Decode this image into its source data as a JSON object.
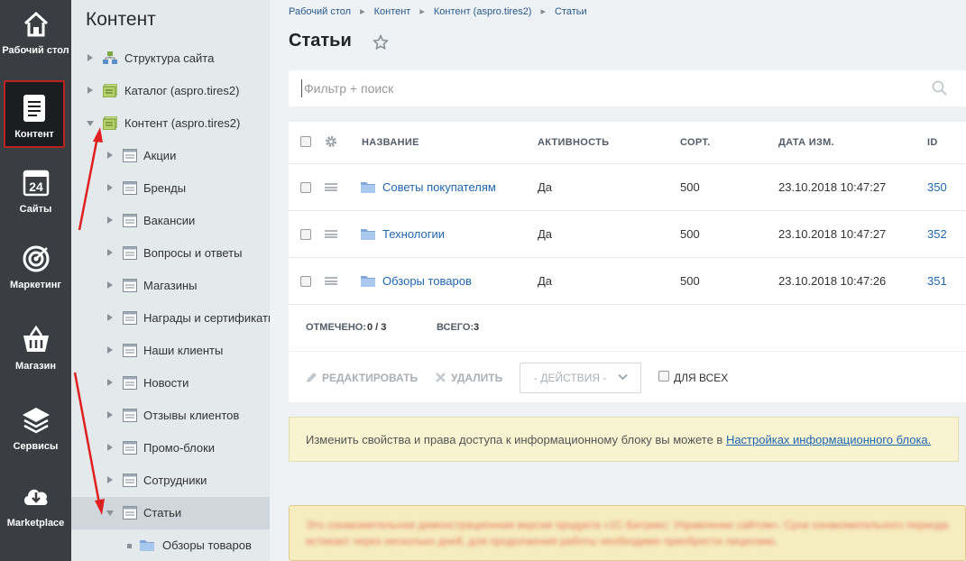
{
  "rail": {
    "items": [
      {
        "label": "Рабочий стол",
        "icon": "home-icon"
      },
      {
        "label": "Контент",
        "icon": "document-icon",
        "active": true
      },
      {
        "label": "Сайты",
        "icon": "calendar-24-icon"
      },
      {
        "label": "Маркетинг",
        "icon": "target-icon"
      },
      {
        "label": "Магазин",
        "icon": "basket-icon"
      },
      {
        "label": "Сервисы",
        "icon": "layers-icon"
      },
      {
        "label": "Marketplace",
        "icon": "cloud-download-icon"
      }
    ]
  },
  "tree": {
    "title": "Контент",
    "items": [
      {
        "label": "Структура сайта",
        "icon": "site-structure-icon"
      },
      {
        "label": "Каталог (aspro.tires2)",
        "icon": "iblock-type-icon"
      },
      {
        "label": "Контент (aspro.tires2)",
        "icon": "iblock-type-icon",
        "expanded": true
      },
      {
        "label": "Акции",
        "icon": "iblock-icon"
      },
      {
        "label": "Бренды",
        "icon": "iblock-icon"
      },
      {
        "label": "Вакансии",
        "icon": "iblock-icon"
      },
      {
        "label": "Вопросы и ответы",
        "icon": "iblock-icon"
      },
      {
        "label": "Магазины",
        "icon": "iblock-icon"
      },
      {
        "label": "Награды и сертификаты",
        "icon": "iblock-icon"
      },
      {
        "label": "Наши клиенты",
        "icon": "iblock-icon"
      },
      {
        "label": "Новости",
        "icon": "iblock-icon"
      },
      {
        "label": "Отзывы клиентов",
        "icon": "iblock-icon"
      },
      {
        "label": "Промо-блоки",
        "icon": "iblock-icon"
      },
      {
        "label": "Сотрудники",
        "icon": "iblock-icon"
      },
      {
        "label": "Статьи",
        "icon": "iblock-icon",
        "expanded": true,
        "selected": true
      },
      {
        "label": "Обзоры товаров",
        "icon": "folder-icon"
      }
    ]
  },
  "breadcrumb": [
    "Рабочий стол",
    "Контент",
    "Контент (aspro.tires2)",
    "Статьи"
  ],
  "page": {
    "title": "Статьи"
  },
  "filter": {
    "placeholder": "Фильтр + поиск"
  },
  "grid": {
    "columns": [
      "НАЗВАНИЕ",
      "АКТИВНОСТЬ",
      "СОРТ.",
      "ДАТА ИЗМ.",
      "ID"
    ],
    "rows": [
      {
        "name": "Советы покупателям",
        "active": "Да",
        "sort": "500",
        "date": "23.10.2018 10:47:27",
        "id": "350"
      },
      {
        "name": "Технологии",
        "active": "Да",
        "sort": "500",
        "date": "23.10.2018 10:47:27",
        "id": "352"
      },
      {
        "name": "Обзоры товаров",
        "active": "Да",
        "sort": "500",
        "date": "23.10.2018 10:47:26",
        "id": "351"
      }
    ],
    "footer": {
      "checked_label": "ОТМЕЧЕНО:",
      "checked_value": "0 / 3",
      "total_label": "ВСЕГО:",
      "total_value": "3"
    },
    "actions": {
      "edit": "РЕДАКТИРОВАТЬ",
      "delete": "УДАЛИТЬ",
      "actions_select": "- ДЕЙСТВИЯ -",
      "for_all": "ДЛЯ ВСЕХ"
    }
  },
  "notice": {
    "text": "Изменить свойства и права доступа к информационному блоку вы можете в ",
    "link": "Настройках информационного блока."
  },
  "warning": {
    "text": "Это ознакомительная демонстрационная версия продукта «1С-Битрикс: Управление сайтом». Срок ознакомительного периода истекает через несколько дней, для продолжения работы необходимо приобрести лицензию."
  },
  "colors": {
    "rail_bg": "#3a3d42",
    "active_border": "#b22222",
    "link": "#2067b0",
    "annotation_arrow": "#e02020"
  }
}
